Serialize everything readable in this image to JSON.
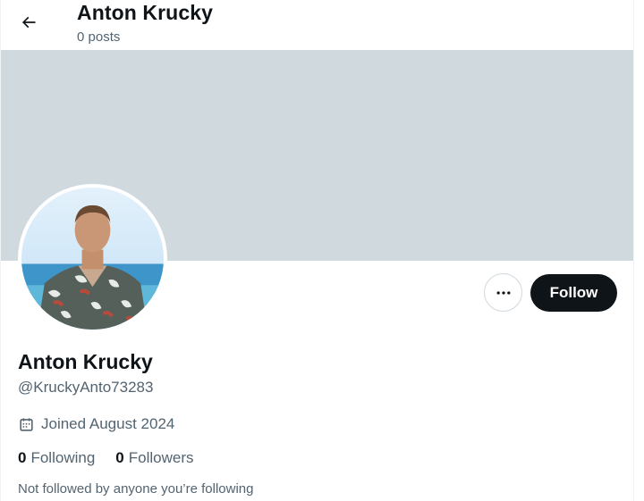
{
  "header": {
    "title": "Anton Krucky",
    "post_count": "0 posts"
  },
  "profile": {
    "display_name": "Anton Krucky",
    "handle": "@KruckyAnto73283",
    "joined": "Joined August 2024",
    "following": {
      "count": "0",
      "label": "Following"
    },
    "followers": {
      "count": "0",
      "label": "Followers"
    },
    "not_followed_note": "Not followed by anyone you’re following"
  },
  "actions": {
    "follow_label": "Follow"
  },
  "colors": {
    "banner": "#cfd9de",
    "follow_button": "#0f1419",
    "secondary_text": "#536471"
  },
  "icons": {
    "back": "arrow-left-icon",
    "more": "more-horizontal-icon",
    "calendar": "calendar-icon"
  }
}
